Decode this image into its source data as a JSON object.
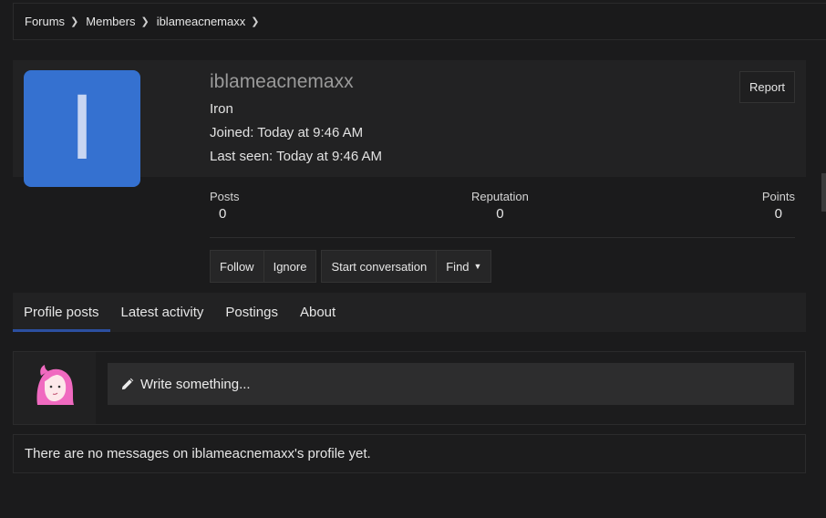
{
  "breadcrumb": [
    {
      "label": "Forums"
    },
    {
      "label": "Members"
    },
    {
      "label": "iblameacnemaxx"
    }
  ],
  "profile": {
    "avatar_letter": "I",
    "avatar_color": "#3571d0",
    "username": "iblameacnemaxx",
    "rank": "Iron",
    "joined": "Joined: Today at 9:46 AM",
    "last_seen": "Last seen: Today at 9:46 AM",
    "report_label": "Report"
  },
  "stats": {
    "posts": {
      "label": "Posts",
      "value": "0"
    },
    "reputation": {
      "label": "Reputation",
      "value": "0"
    },
    "points": {
      "label": "Points",
      "value": "0"
    }
  },
  "actions": {
    "follow": "Follow",
    "ignore": "Ignore",
    "start_conversation": "Start conversation",
    "find": "Find"
  },
  "tabs": [
    {
      "label": "Profile posts",
      "active": true
    },
    {
      "label": "Latest activity"
    },
    {
      "label": "Postings"
    },
    {
      "label": "About"
    }
  ],
  "composer": {
    "placeholder": "Write something..."
  },
  "empty_message": "There are no messages on iblameacnemaxx's profile yet.",
  "colors": {
    "accent": "#2c4fa0",
    "background": "#1b1b1c"
  }
}
